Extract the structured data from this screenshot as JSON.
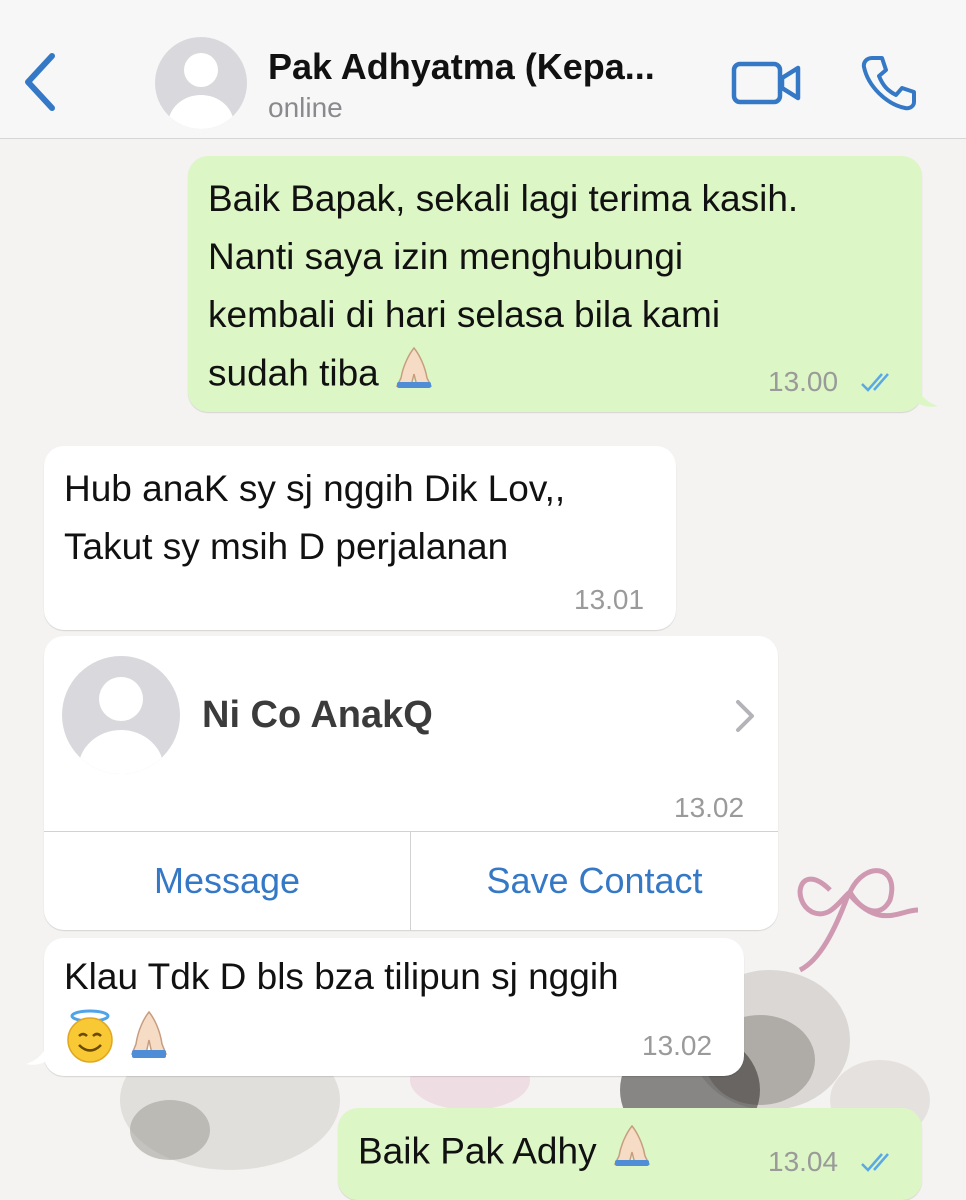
{
  "header": {
    "contact_name": "Pak Adhyatma (Kepa...",
    "status": "online"
  },
  "messages": [
    {
      "text": "Baik Bapak, sekali lagi terima kasih.\nNanti saya izin menghubungi\nkembali di hari selasa bila kami\nsudah tiba",
      "emoji": "folded-hands-emoji",
      "time": "13.00",
      "read": true
    },
    {
      "text": "Hub anaK sy sj nggih Dik Lov,,\nTakut sy msih D perjalanan",
      "time": "13.01"
    },
    {
      "text": "Klau Tdk D bls bza tilipun sj nggih",
      "emoji": "smiling-halo-and-folded-hands-emoji",
      "time": "13.02"
    },
    {
      "text": "Baik Pak Adhy",
      "emoji": "folded-hands-emoji",
      "time": "13.04",
      "read": true
    }
  ],
  "contact_card": {
    "name": "Ni Co AnakQ",
    "time": "13.02",
    "message_label": "Message",
    "save_label": "Save Contact"
  },
  "colors": {
    "accent": "#3478c6",
    "outgoing_bubble": "#dcf7c5",
    "incoming_bubble": "#ffffff",
    "read_ticks": "#5aa9e6"
  }
}
